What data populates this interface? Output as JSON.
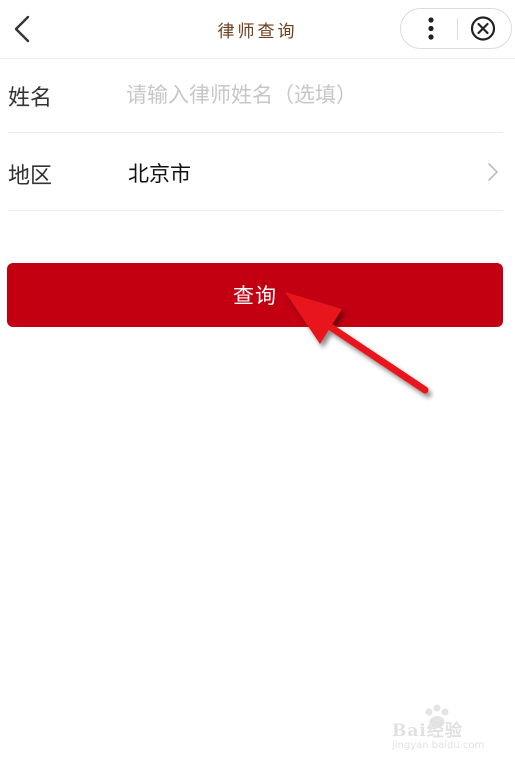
{
  "nav": {
    "title": "律师查询",
    "back_icon": "chevron-left-icon",
    "more_icon": "more-vertical-icon",
    "close_icon": "close-circle-icon"
  },
  "form": {
    "name_label": "姓名",
    "name_value": "",
    "name_placeholder": "请输入律师姓名（选填）",
    "region_label": "地区",
    "region_value": "北京市",
    "region_icon": "chevron-right-icon"
  },
  "query_button": {
    "label": "查询",
    "color": "#c20012"
  },
  "annotation": {
    "icon": "red-arrow-icon",
    "color": "#e8141a"
  },
  "watermark": {
    "brand": "Bai经验",
    "url": "jingyan.baidu.com"
  },
  "colors": {
    "title": "#6b3e1e",
    "placeholder": "#c7c7c7",
    "divider": "#ececec"
  }
}
